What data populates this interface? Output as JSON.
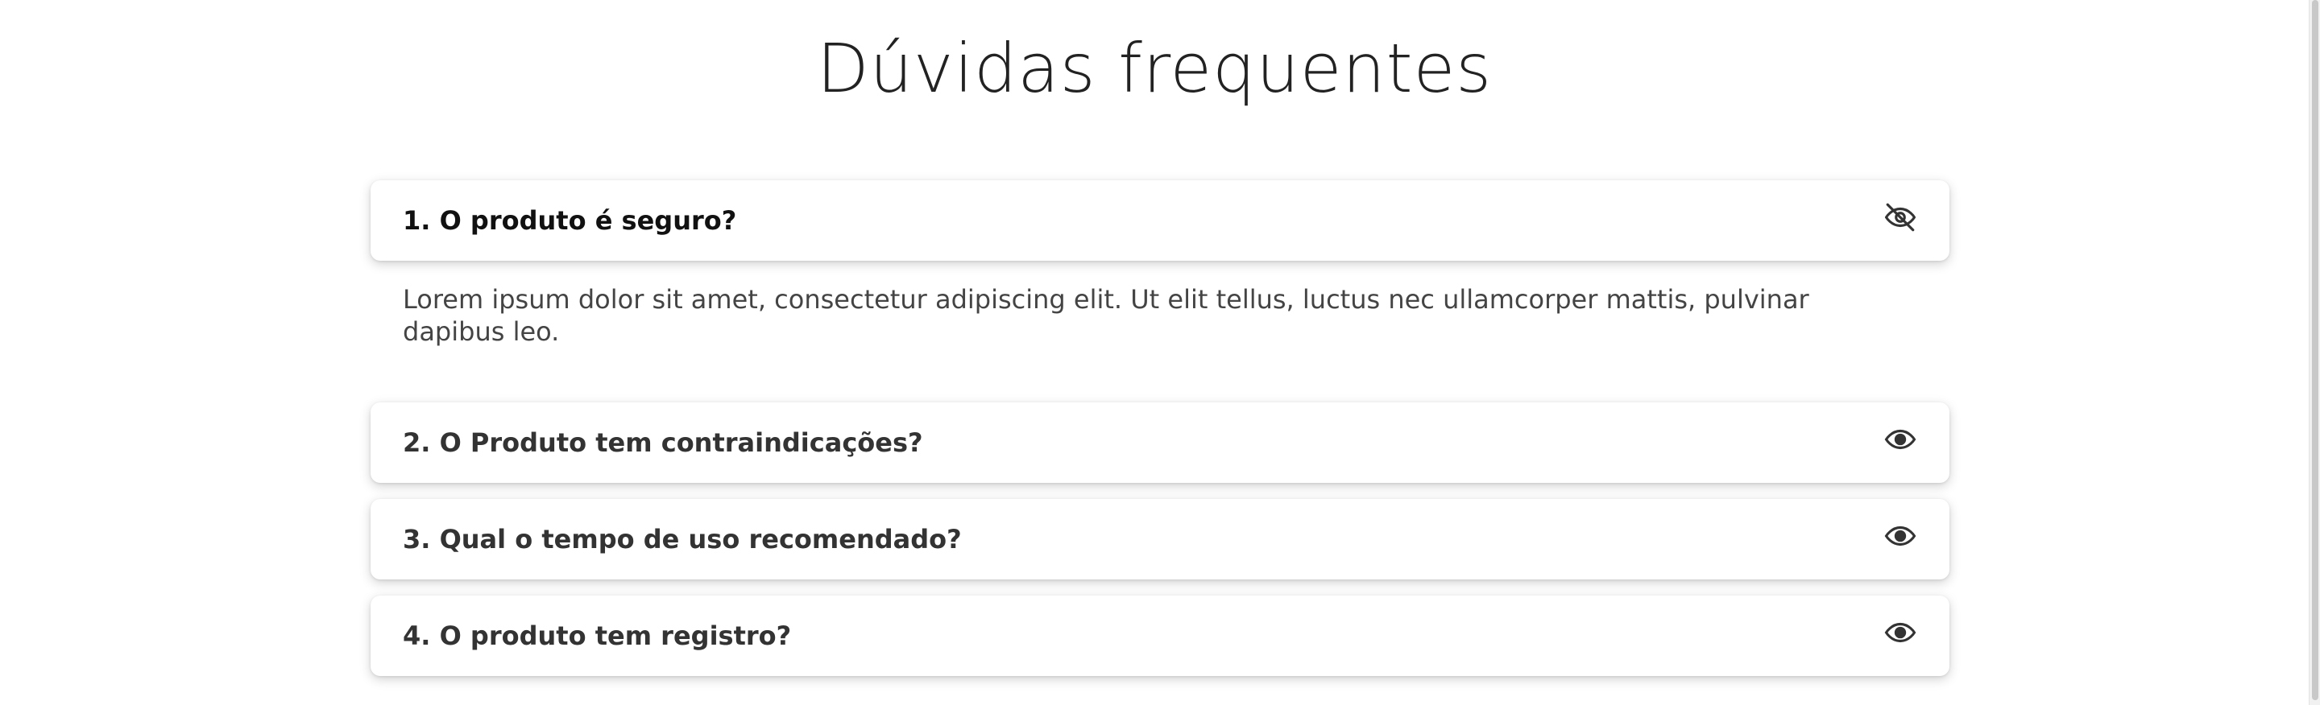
{
  "faq": {
    "title": "Dúvidas frequentes",
    "items": [
      {
        "question": "1. O produto é seguro?",
        "answer": "Lorem ipsum dolor sit amet, consectetur adipiscing elit. Ut elit tellus, luctus nec ullamcorper mattis, pulvinar dapibus leo.",
        "expanded": true,
        "icon": "eye-slash-icon"
      },
      {
        "question": "2. O Produto tem contraindicações?",
        "expanded": false,
        "icon": "eye-icon"
      },
      {
        "question": "3. Qual o tempo de uso recomendado?",
        "expanded": false,
        "icon": "eye-icon"
      },
      {
        "question": "4. O produto tem registro?",
        "expanded": false,
        "icon": "eye-icon"
      }
    ]
  },
  "colors": {
    "heading": "#222222",
    "question": "#333333",
    "answer": "#444444",
    "card": "#ffffff"
  }
}
